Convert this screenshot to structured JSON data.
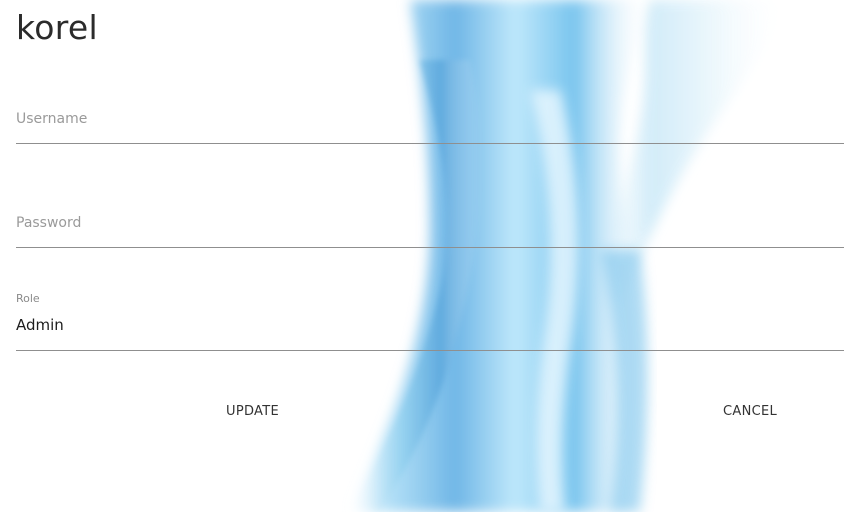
{
  "app": {
    "title": "korel"
  },
  "form": {
    "username": {
      "value": "",
      "placeholder": "Username"
    },
    "password": {
      "value": "",
      "placeholder": "Password"
    },
    "role": {
      "label": "Role",
      "value": "Admin"
    }
  },
  "actions": {
    "update_label": "UPDATE",
    "cancel_label": "CANCEL"
  },
  "theme": {
    "background": "#ffffff",
    "accent": "#8fd3f4",
    "underline": "#8f8f8f"
  }
}
